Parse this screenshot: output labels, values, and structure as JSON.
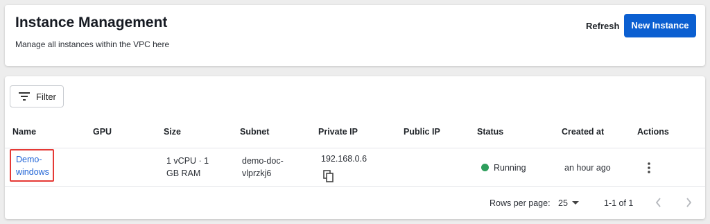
{
  "header": {
    "title": "Instance Management",
    "subtitle": "Manage all instances within the VPC here",
    "refresh_label": "Refresh",
    "new_instance_label": "New Instance",
    "accent_color": "#0b5fd1"
  },
  "toolbar": {
    "filter_label": "Filter",
    "filter_icon": "filter-lines-icon"
  },
  "table": {
    "columns": [
      "Name",
      "GPU",
      "Size",
      "Subnet",
      "Private IP",
      "Public IP",
      "Status",
      "Created at",
      "Actions"
    ],
    "rows": [
      {
        "name_line1": "Demo-",
        "name_line2": "windows",
        "gpu": "",
        "size_line1": "1 vCPU · 1",
        "size_line2": "GB RAM",
        "subnet_line1": "demo-doc-",
        "subnet_line2": "vlprzkj6",
        "private_ip": "192.168.0.6",
        "public_ip": "",
        "status": "Running",
        "status_color": "#2e9e5c",
        "created_at": "an hour ago",
        "copy_icon": "copy-icon",
        "actions_icon": "more-vertical-icon"
      }
    ]
  },
  "pagination": {
    "rows_per_page_label": "Rows per page:",
    "rows_per_page_value": "25",
    "range_text": "1-1 of 1"
  }
}
